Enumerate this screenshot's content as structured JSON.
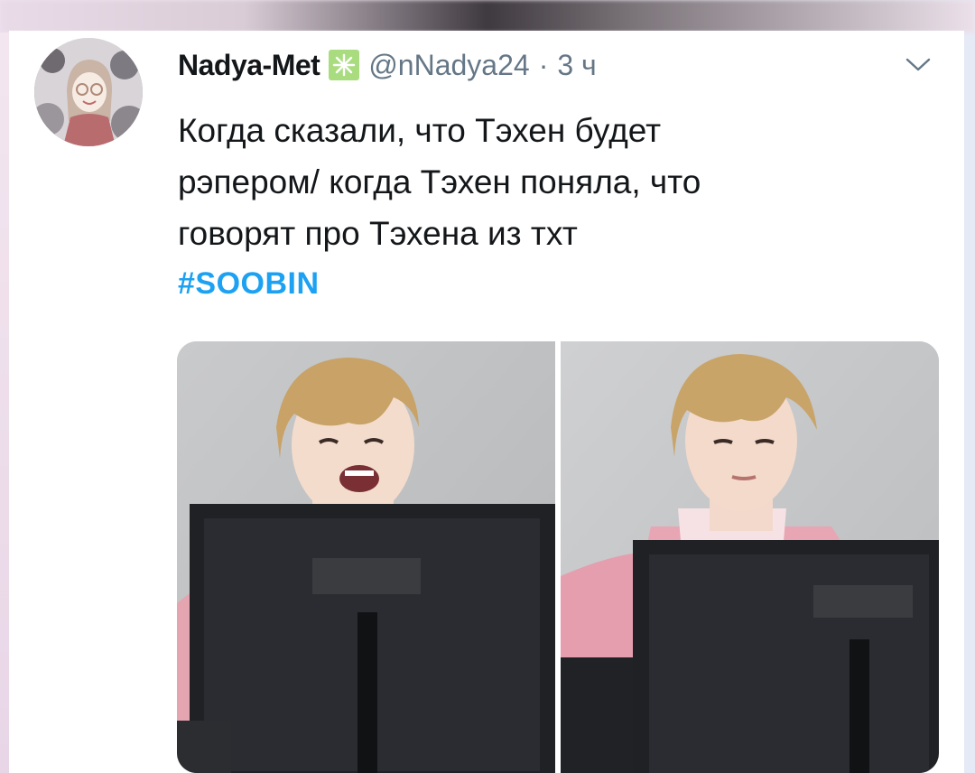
{
  "tweet": {
    "author": {
      "display_name": "Nadya-Met",
      "handle": "@nNadya24",
      "separator": "·",
      "time": "3 ч",
      "badge_icon": "snowflake-icon"
    },
    "text_lines": [
      "Когда сказали, что Тэхен будет",
      "рэпером/ когда Тэхен поняла, что",
      "говорят про Тэхена из тхт"
    ],
    "hashtag": "#SOOBIN",
    "menu_icon": "chevron-down-icon",
    "media": [
      {
        "description_icon": "photo-laughing",
        "expression": "laughing"
      },
      {
        "description_icon": "photo-neutral",
        "expression": "neutral"
      }
    ]
  },
  "colors": {
    "text": "#14171a",
    "muted": "#657786",
    "hashtag": "#1da1f2",
    "badge": "#a9dc7e",
    "jacket": "#e7a3b3",
    "hair": "#c8a266",
    "monitor": "#1f2125"
  }
}
